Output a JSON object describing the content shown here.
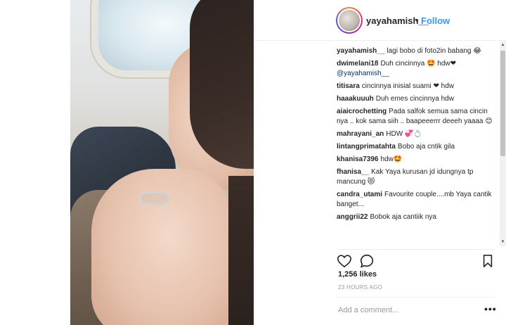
{
  "post": {
    "username": "yayahamish__",
    "separator": "•",
    "follow_label": "Follow",
    "likes": "1,256 likes",
    "time": "23 HOURS AGO",
    "add_comment_placeholder": "Add a comment...",
    "more_label": "•••"
  },
  "icons": {
    "heart": "heart-icon",
    "comment": "comment-icon",
    "bookmark": "bookmark-icon",
    "scroll_up": "scroll-up-icon",
    "scroll_down": "scroll-down-icon"
  },
  "colors": {
    "follow": "#3897f0",
    "text": "#262626",
    "muted": "#999999"
  },
  "comments": [
    {
      "user": "yayahamish__",
      "text": "lagi bobo di foto2in babang 😂"
    },
    {
      "user": "dwimelani18",
      "text": "Duh cincinnya 🤩 hdw❤",
      "mention": "@yayahamish__"
    },
    {
      "user": "titisara",
      "text": "cincinnya inisial suami ❤ hdw"
    },
    {
      "user": "haaakuuuh",
      "text": "Duh emes cincinnya hdw"
    },
    {
      "user": "aiaicrochetting",
      "text": "Pada salfok semua sama cincin nya .. kok sama siih .. baapeeerrr deeeh yaaaa 😊"
    },
    {
      "user": "mahrayani_an",
      "text": "HDW 💞💍"
    },
    {
      "user": "lintangprimatahta",
      "text": "Bobo aja cntik gila"
    },
    {
      "user": "khanisa7396",
      "text": "hdw🤩"
    },
    {
      "user": "fhanisa__",
      "text": "Kak Yaya kurusan jd idungnya tp mancung 😻"
    },
    {
      "user": "candra_utami",
      "text": "Favourite couple....mb Yaya cantik banget..."
    },
    {
      "user": "anggrii22",
      "text": "Bobok aja cantiik nya"
    }
  ]
}
